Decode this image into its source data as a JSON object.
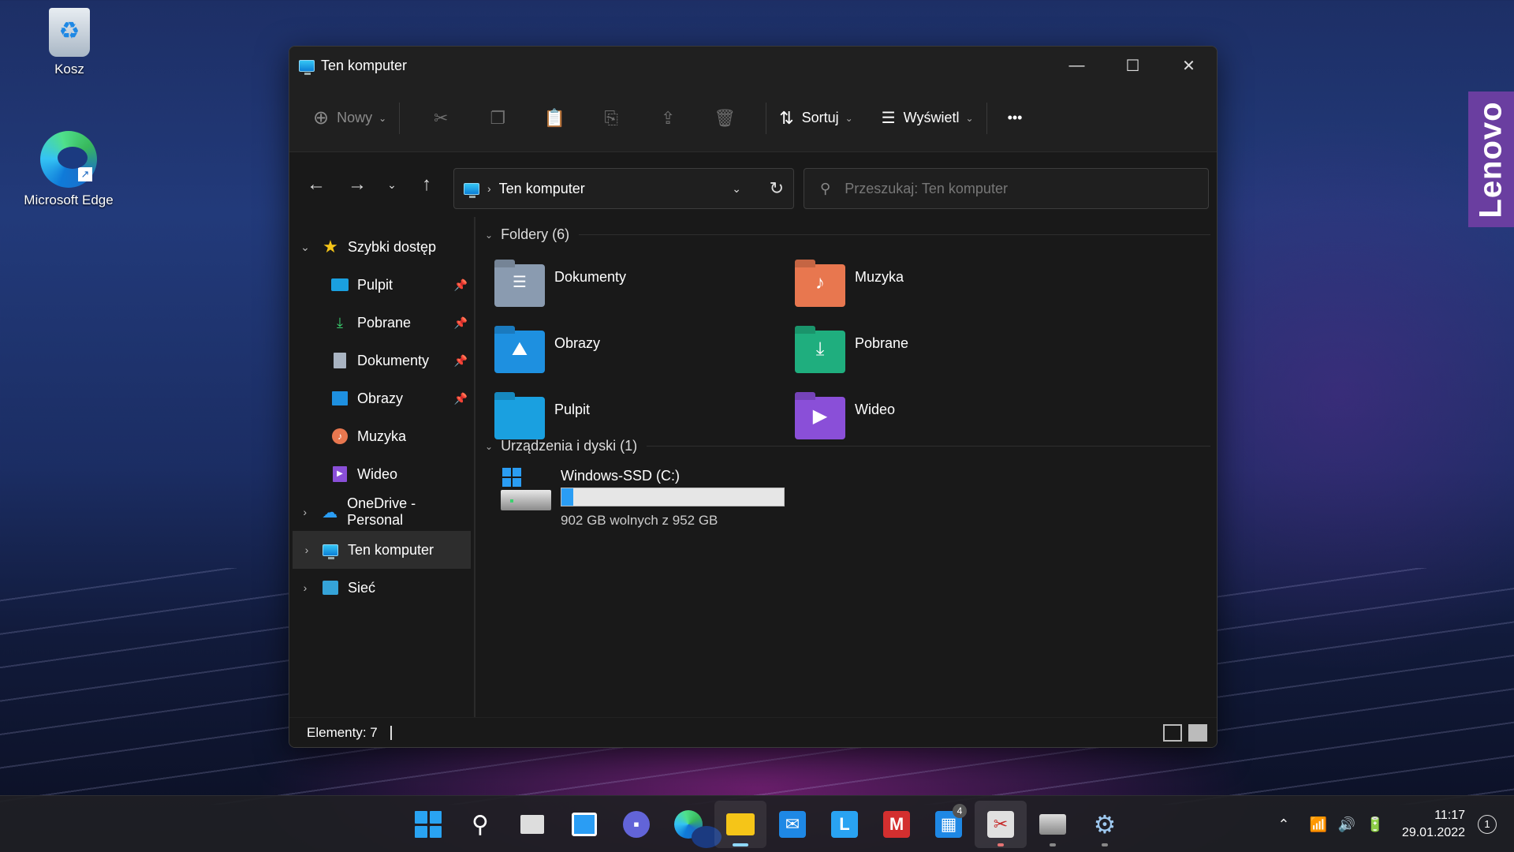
{
  "desktop": {
    "icons": [
      {
        "label": "Kosz"
      },
      {
        "label": "Microsoft Edge"
      }
    ],
    "brand": "Lenovo"
  },
  "window": {
    "title": "Ten komputer",
    "controls": {
      "minimize": "—",
      "maximize": "☐",
      "close": "✕"
    }
  },
  "toolbar": {
    "new_label": "Nowy",
    "sort_label": "Sortuj",
    "view_label": "Wyświetl",
    "more_label": "•••"
  },
  "address": {
    "crumb": "Ten komputer"
  },
  "search": {
    "placeholder": "Przeszukaj: Ten komputer"
  },
  "sidebar": {
    "quick_access": "Szybki dostęp",
    "items": [
      {
        "label": "Pulpit",
        "pinned": true
      },
      {
        "label": "Pobrane",
        "pinned": true
      },
      {
        "label": "Dokumenty",
        "pinned": true
      },
      {
        "label": "Obrazy",
        "pinned": true
      },
      {
        "label": "Muzyka",
        "pinned": false
      },
      {
        "label": "Wideo",
        "pinned": false
      }
    ],
    "onedrive": "OneDrive - Personal",
    "this_pc": "Ten komputer",
    "network": "Sieć"
  },
  "content": {
    "folders_header": "Foldery (6)",
    "folders": [
      {
        "name": "Dokumenty",
        "color": "#8a9bb0"
      },
      {
        "name": "Muzyka",
        "color": "#e8774f"
      },
      {
        "name": "Obrazy",
        "color": "#1e90e0"
      },
      {
        "name": "Pobrane",
        "color": "#1fae7e"
      },
      {
        "name": "Pulpit",
        "color": "#1aa0e0"
      },
      {
        "name": "Wideo",
        "color": "#8a4fd8"
      }
    ],
    "devices_header": "Urządzenia i dyski (1)",
    "drive": {
      "name": "Windows-SSD (C:)",
      "free_text": "902 GB wolnych z 952 GB",
      "used_fraction": 0.0525
    }
  },
  "status": {
    "items_text": "Elementy: 7"
  },
  "taskbar": {
    "time": "11:17",
    "date": "29.01.2022",
    "notifications": "1",
    "mail_badge": "4"
  }
}
